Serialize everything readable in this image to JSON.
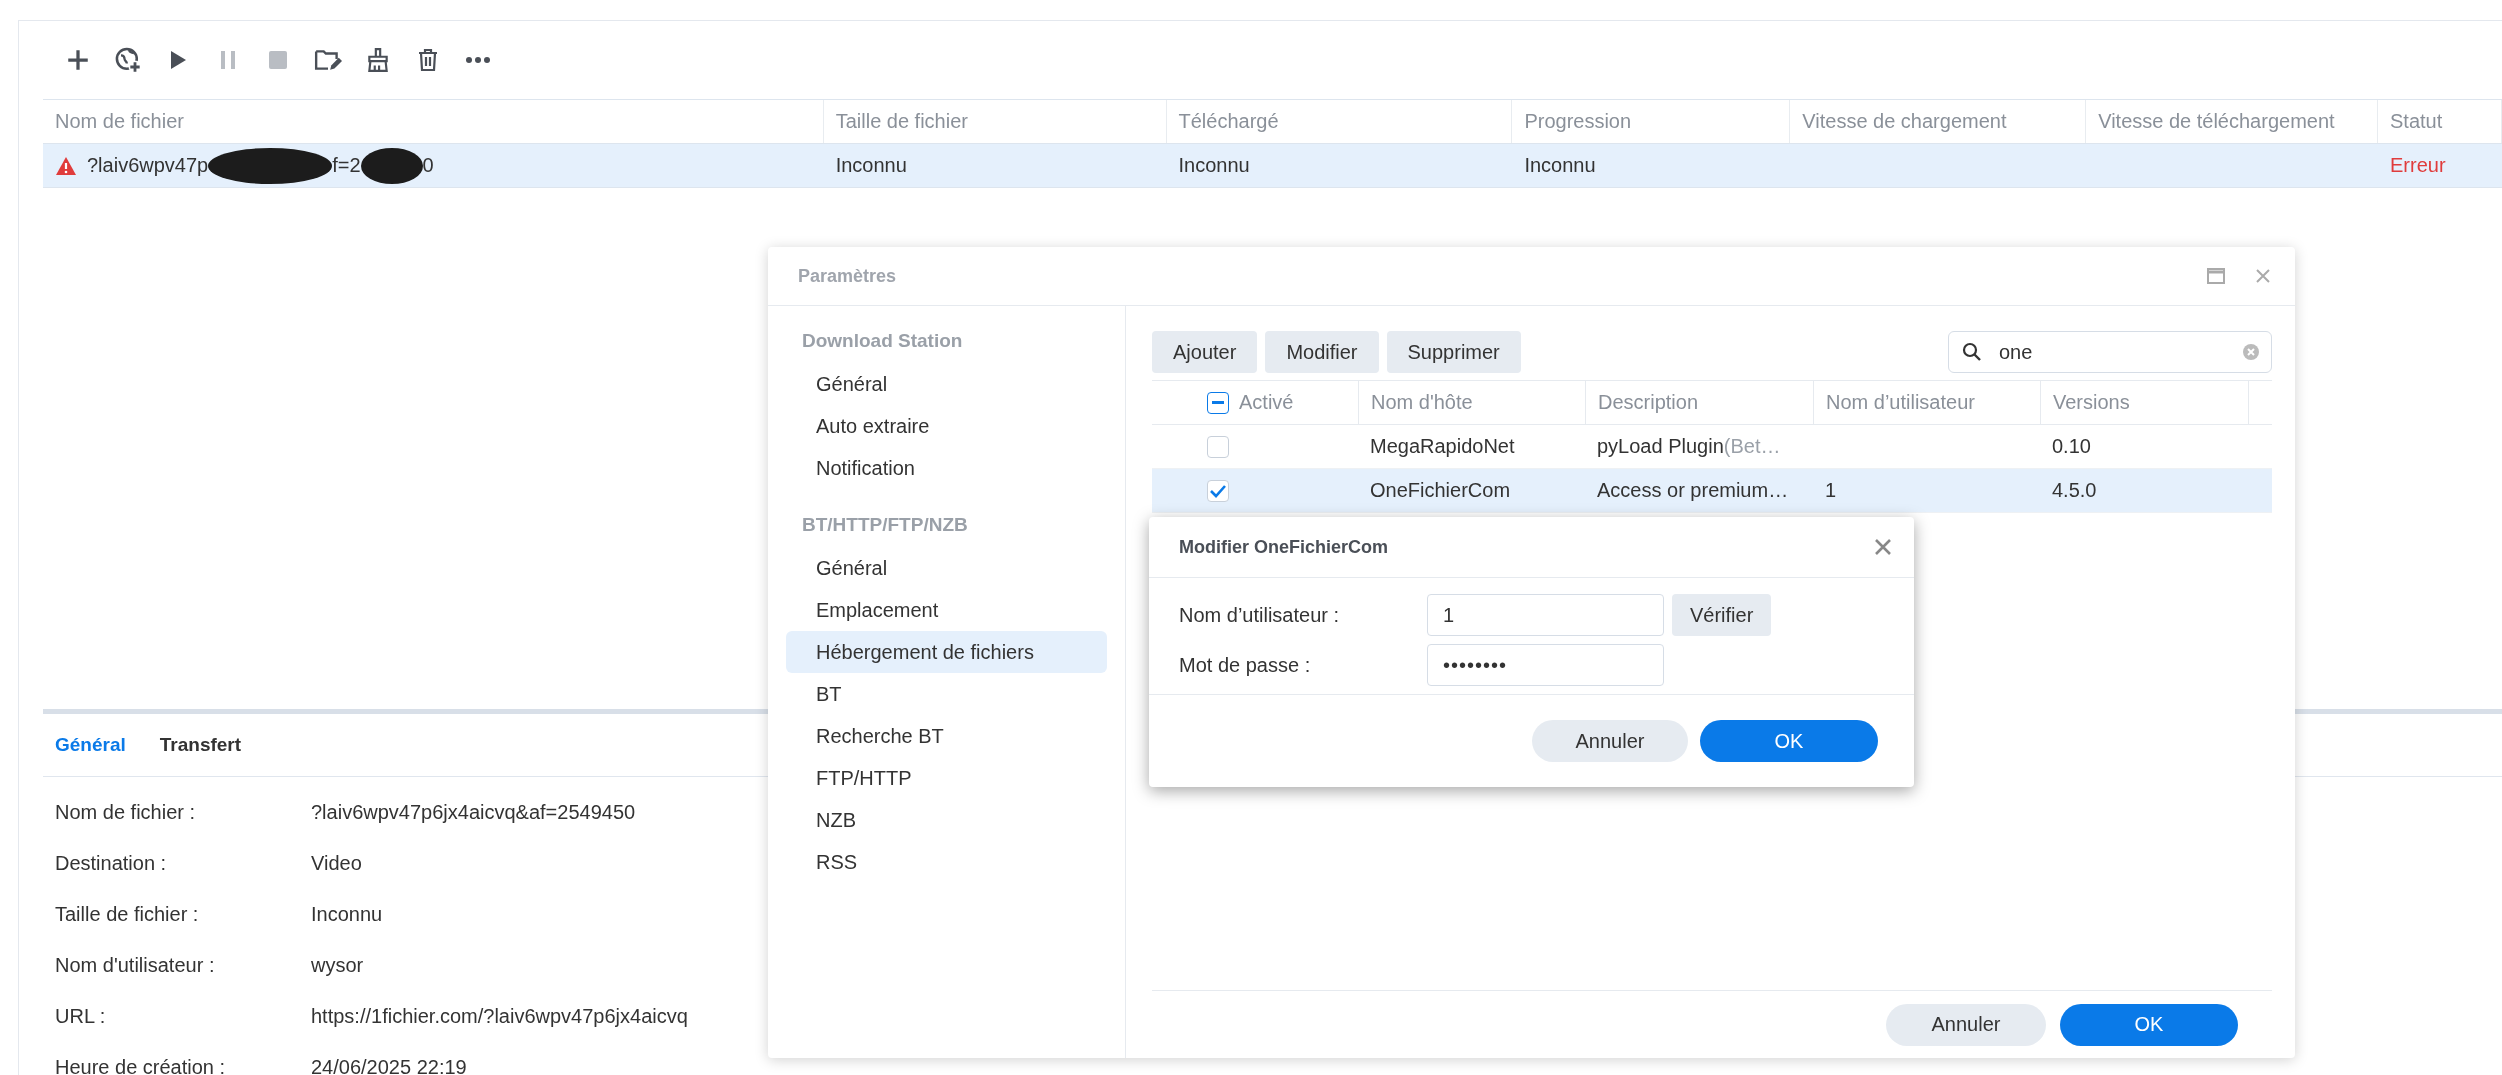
{
  "toolbar": [
    {
      "kind": "add",
      "disabled": false
    },
    {
      "kind": "add-url",
      "disabled": false
    },
    {
      "kind": "play",
      "disabled": false
    },
    {
      "kind": "pause",
      "disabled": true
    },
    {
      "kind": "stop",
      "disabled": true
    },
    {
      "kind": "folder-edit",
      "disabled": false
    },
    {
      "kind": "clean",
      "disabled": false
    },
    {
      "kind": "delete",
      "disabled": false
    },
    {
      "kind": "more",
      "disabled": false
    }
  ],
  "downloads": {
    "columns": [
      "Nom de fichier",
      "Taille de fichier",
      "Téléchargé",
      "Progression",
      "Vitesse de chargement",
      "Vitesse de téléchargement",
      "Statut"
    ],
    "rows": [
      {
        "selected": true,
        "error": true,
        "name_parts": [
          "?laiv6wpv47p",
          "f=2",
          "0"
        ],
        "size": "Inconnu",
        "downloaded": "Inconnu",
        "progress": "Inconnu",
        "status": "Erreur"
      }
    ]
  },
  "details": {
    "tabs": [
      {
        "label": "Général",
        "selected": true
      },
      {
        "label": "Transfert",
        "selected": false
      }
    ],
    "fields": [
      {
        "label": "Nom de fichier :",
        "value": "?laiv6wpv47p6jx4aicvq&af=2549450"
      },
      {
        "label": "Destination :",
        "value": "Video"
      },
      {
        "label": "Taille de fichier :",
        "value": "Inconnu"
      },
      {
        "label": "Nom d'utilisateur :",
        "value": "wysor"
      },
      {
        "label": "URL :",
        "value": "https://1fichier.com/?laiv6wpv47p6jx4aicvq"
      },
      {
        "label": "Heure de création :",
        "value": "24/06/2025 22:19"
      }
    ]
  },
  "settings": {
    "title": "Paramètres",
    "sidebar": [
      {
        "heading": "Download Station",
        "items": [
          {
            "label": "Général",
            "selected": false
          },
          {
            "label": "Auto extraire",
            "selected": false
          },
          {
            "label": "Notification",
            "selected": false
          }
        ]
      },
      {
        "heading": "BT/HTTP/FTP/NZB",
        "items": [
          {
            "label": "Général",
            "selected": false
          },
          {
            "label": "Emplacement",
            "selected": false
          },
          {
            "label": "Hébergement de fichiers",
            "selected": true
          },
          {
            "label": "BT",
            "selected": false
          },
          {
            "label": "Recherche BT",
            "selected": false
          },
          {
            "label": "FTP/HTTP",
            "selected": false
          },
          {
            "label": "NZB",
            "selected": false
          },
          {
            "label": "RSS",
            "selected": false
          }
        ]
      }
    ],
    "actions": [
      "Ajouter",
      "Modifier",
      "Supprimer"
    ],
    "search": {
      "value": "one"
    },
    "columns": [
      "Activé",
      "Nom d'hôte",
      "Description",
      "Nom d’utilisateur",
      "Versions"
    ],
    "header_indeterminate": true,
    "rows": [
      {
        "checked": false,
        "selected": false,
        "host": "MegaRapidoNet",
        "description": "pyLoad Plugin",
        "description_note": "(Bet…",
        "version": "0.10"
      },
      {
        "checked": true,
        "selected": true,
        "host": "OneFichierCom",
        "description": "Access or premium…",
        "user": "1",
        "version": "4.5.0"
      }
    ],
    "buttons": [
      {
        "label": "Annuler",
        "kind": "secondary"
      },
      {
        "label": "OK",
        "kind": "primary"
      }
    ]
  },
  "modal": {
    "title": "Modifier OneFichierCom",
    "fields": [
      {
        "label": "Nom d’utilisateur :",
        "value": "1",
        "kind": "text",
        "action": "Vérifier"
      },
      {
        "label": "Mot de passe :",
        "value": "••••••••",
        "kind": "password"
      }
    ],
    "buttons": [
      {
        "label": "Annuler",
        "kind": "secondary"
      },
      {
        "label": "OK",
        "kind": "primary"
      }
    ]
  }
}
